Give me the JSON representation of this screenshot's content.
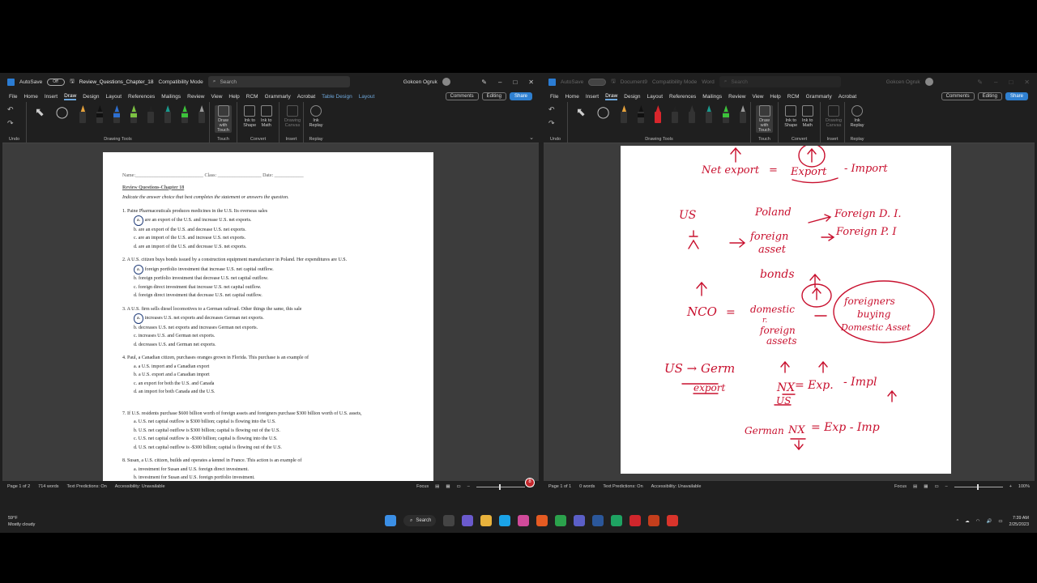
{
  "left": {
    "autosave_label": "AutoSave",
    "autosave_state": "Off",
    "doc_name": "Review_Questions_Chapter_18",
    "mode": "Compatibility Mode",
    "search_placeholder": "Search",
    "user": "Gokcen Ogruk",
    "menu": [
      "File",
      "Home",
      "Insert",
      "Draw",
      "Design",
      "Layout",
      "References",
      "Mailings",
      "Review",
      "View",
      "Help",
      "RCM",
      "Grammarly",
      "Acrobat"
    ],
    "menu_context": [
      "Table Design",
      "Layout"
    ],
    "comments": "Comments",
    "editing": "Editing",
    "share": "Share",
    "ribbon": {
      "undo": "Undo",
      "drawing_tools": "Drawing Tools",
      "draw_with_touch": "Draw with Touch",
      "touch": "Touch",
      "ink_to_shape": "Ink to Shape",
      "ink_to_math": "Ink to Math",
      "convert": "Convert",
      "drawing_canvas": "Drawing Canvas",
      "insert": "Insert",
      "ink_replay": "Ink Replay",
      "replay": "Replay"
    },
    "status": {
      "page": "Page 1 of 2",
      "words": "714 words",
      "predictions": "Text Predictions: On",
      "accessibility": "Accessibility: Unavailable",
      "focus": "Focus"
    },
    "doc": {
      "name_line": "Name:____________________________ Class: __________________ Date: ____________",
      "title": "Review Questions-Chapter 18",
      "instruction": "Indicate the answer choice that best completes the statement or answers the question.",
      "q1": "1. Paine Pharmaceuticals produces medicines in the U.S. Its overseas sales",
      "q1a_letter": "a.",
      "q1a": " are an export of the U.S. and increase U.S. net exports.",
      "q1b": "b. are an export of the U.S. and decrease U.S. net exports.",
      "q1c": "c. are an import of the U.S. and increase U.S. net exports.",
      "q1d": "d. are an import of the U.S. and decrease U.S. net exports.",
      "q2": "2. A U.S. citizen buys bonds issued by a construction equipment manufacturer in Poland. Her expenditures are U.S.",
      "q2a_letter": "a.",
      "q2a": " foreign portfolio investment that increase U.S. net capital outflow.",
      "q2b": "b. foreign portfolio investment that decrease U.S. net capital outflow.",
      "q2c": "c. foreign direct investment that increase U.S. net capital outflow.",
      "q2d": "d. foreign direct investment that decrease U.S. net capital outflow.",
      "q3": "3. A U.S. firm sells diesel locomotives to a German railroad. Other things the same, this sale",
      "q3a_letter": "a.",
      "q3a": " increases U.S. net exports and decreases German net exports.",
      "q3b": "b. decreases U.S. net exports and increases German net exports.",
      "q3c": "c. increases U.S. and German net exports.",
      "q3d": "d. decreases U.S. and German net exports.",
      "q4": "4. Paul, a Canadian citizen, purchases oranges grown in Florida. This purchase is an example of",
      "q4a": "a. a U.S. import and a Canadian export",
      "q4b": "b. a U.S. export and a Canadian import",
      "q4c": "c. an export for both the U.S. and Canada",
      "q4d": "d. an import for both Canada and the U.S.",
      "q7": "7. If U.S. residents purchase $600 billion worth of foreign assets and foreigners purchase $300 billion worth of U.S. assets,",
      "q7a": "a. U.S. net capital outflow is $300 billion; capital is flowing into the U.S.",
      "q7b": "b. U.S. net capital outflow is $300 billion; capital is flowing out of the U.S.",
      "q7c": "c. U.S. net capital outflow is -$300 billion; capital is flowing into the U.S.",
      "q7d": "d. U.S. net capital outflow is -$300 billion; capital is flowing out of the U.S.",
      "q8": "8. Susan, a U.S. citizen, builds and operates a kennel in France. This action is an example of",
      "q8a": "a. investment for Susan and U.S. foreign direct investment.",
      "q8b": "b. investment for Susan and U.S. foreign portfolio investment."
    }
  },
  "right": {
    "autosave_label": "AutoSave",
    "doc_name": "Document9",
    "mode": "Compatibility Mode",
    "app": "Word",
    "search_placeholder": "Search",
    "user": "Gokcen Ogruk",
    "menu": [
      "File",
      "Home",
      "Insert",
      "Draw",
      "Design",
      "Layout",
      "References",
      "Mailings",
      "Review",
      "View",
      "Help",
      "RCM",
      "Grammarly",
      "Acrobat"
    ],
    "comments": "Comments",
    "editing": "Editing",
    "share": "Share",
    "status": {
      "page": "Page 1 of 1",
      "words": "0 words",
      "predictions": "Text Predictions: On",
      "accessibility": "Accessibility: Unavailable",
      "focus": "Focus",
      "zoom": "100%"
    },
    "ink": {
      "net_export": "Net export",
      "eq": "=",
      "export": "Export",
      "import": "- Import",
      "us": "US",
      "poland": "Poland",
      "foreign_di": "Foreign D. I.",
      "foreign_pi": "Foreign P. I",
      "foreign": "foreign",
      "asset": "asset",
      "bonds": "bonds",
      "nco": "NCO",
      "domestic": "domestic",
      "r": "r.",
      "foreign2": "foreign",
      "assets": "assets",
      "foreigners": "foreigners",
      "buying": "buying",
      "domestic_asset": "Domestic Asset",
      "us_germ": "US → Germ",
      "export_word": "export",
      "nx": "NX",
      "exp": "= Exp.",
      "impl": "- Impl",
      "us2": "US",
      "german": "German",
      "exp2": "= Exp - Imp"
    }
  },
  "taskbar": {
    "temp": "59°F",
    "weather": "Mostly cloudy",
    "search": "Search",
    "time": "7:39 AM",
    "date": "2/25/2023",
    "notification": "8"
  }
}
